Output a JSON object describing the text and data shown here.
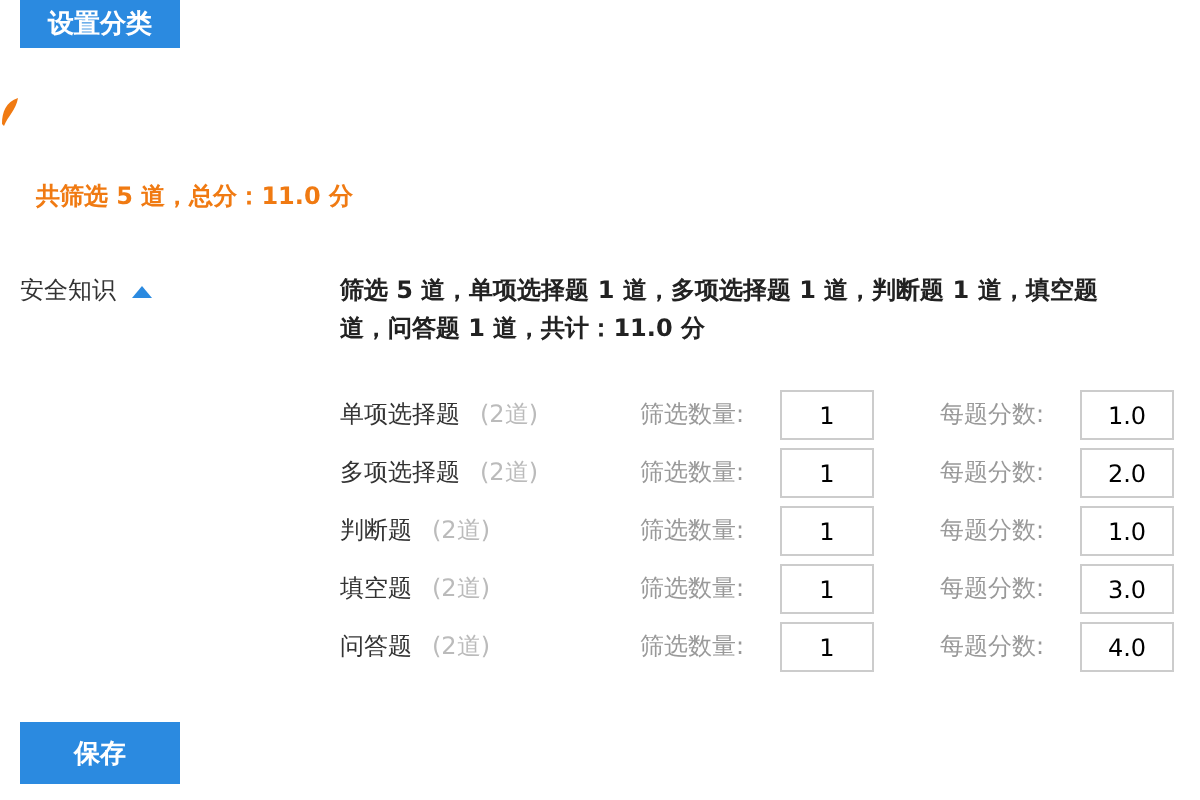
{
  "top_button": "设置分类",
  "total": "共筛选 5 道，总分：11.0 分",
  "category": {
    "name": "安全知识",
    "expanded": true,
    "summary_lines": [
      "筛选 5 道，单项选择题 1 道，多项选择题 1 道，判断题 1 道，填空题",
      "道，问答题 1 道，共计：11.0 分"
    ],
    "rows": [
      {
        "type": "单项选择题",
        "available": "(2道)",
        "count_label": "筛选数量:",
        "count": "1",
        "score_label": "每题分数:",
        "score": "1.0"
      },
      {
        "type": "多项选择题",
        "available": "(2道)",
        "count_label": "筛选数量:",
        "count": "1",
        "score_label": "每题分数:",
        "score": "2.0"
      },
      {
        "type": "判断题",
        "available": "(2道)",
        "count_label": "筛选数量:",
        "count": "1",
        "score_label": "每题分数:",
        "score": "1.0"
      },
      {
        "type": "填空题",
        "available": "(2道)",
        "count_label": "筛选数量:",
        "count": "1",
        "score_label": "每题分数:",
        "score": "3.0"
      },
      {
        "type": "问答题",
        "available": "(2道)",
        "count_label": "筛选数量:",
        "count": "1",
        "score_label": "每题分数:",
        "score": "4.0"
      }
    ]
  },
  "save_button": "保存"
}
